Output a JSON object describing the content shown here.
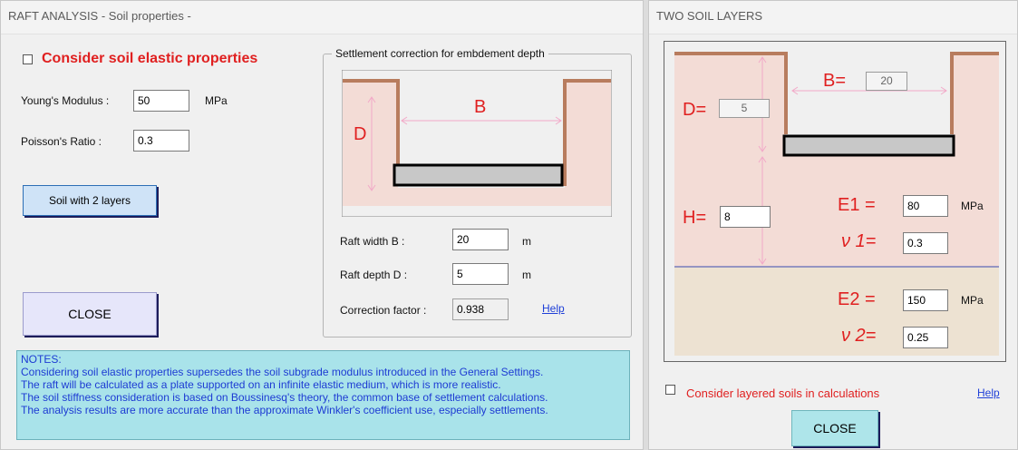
{
  "left_window": {
    "title": "RAFT ANALYSIS - Soil properties -",
    "consider_elastic_label": "Consider soil elastic properties",
    "youngs_label": "Young's Modulus :",
    "youngs_value": "50",
    "youngs_unit": "MPa",
    "poisson_label": "Poisson's Ratio :",
    "poisson_value": "0.3",
    "soil_layers_button": "Soil with 2 layers",
    "close_button": "CLOSE",
    "settlement_group": {
      "title": "Settlement correction for embdement depth",
      "diagram_B": "B",
      "diagram_D": "D",
      "raft_width_label": "Raft width B :",
      "raft_width_value": "20",
      "raft_width_unit": "m",
      "raft_depth_label": "Raft depth D :",
      "raft_depth_value": "5",
      "raft_depth_unit": "m",
      "correction_label": "Correction factor :",
      "correction_value": "0.938",
      "help_link": "Help"
    },
    "notes": {
      "heading": "NOTES:",
      "lines": [
        "Considering soil elastic properties supersedes the soil subgrade modulus introduced in the General Settings.",
        "The raft will be calculated as a plate supported on an infinite elastic medium, which is more realistic.",
        "The soil stiffness consideration is based on Boussinesq's theory, the common base of settlement calculations.",
        "The analysis results are more accurate than the approximate Winkler's coefficient use, especially settlements."
      ]
    }
  },
  "right_window": {
    "title": "TWO SOIL LAYERS",
    "B_label": "B=",
    "B_value": "20",
    "D_label": "D=",
    "D_value": "5",
    "H_label": "H=",
    "H_value": "8",
    "E1_label": "E1  =",
    "E1_value": "80",
    "E1_unit": "MPa",
    "nu1_label": "ν 1=",
    "nu1_value": "0.3",
    "E2_label": "E2  =",
    "E2_value": "150",
    "E2_unit": "MPa",
    "nu2_label": "ν 2=",
    "nu2_value": "0.25",
    "consider_layered_label": "Consider layered soils in calculations",
    "help_link": "Help",
    "close_button": "CLOSE"
  },
  "colors": {
    "soil_fill": "#f3dcd6",
    "lower_soil_fill": "#ede2d2",
    "wall_brown": "#b87c5e",
    "dim_pink": "#f2a9c8",
    "red_text": "#e02020",
    "link_blue": "#1f40d8",
    "notes_bg": "#a9e3ea"
  }
}
